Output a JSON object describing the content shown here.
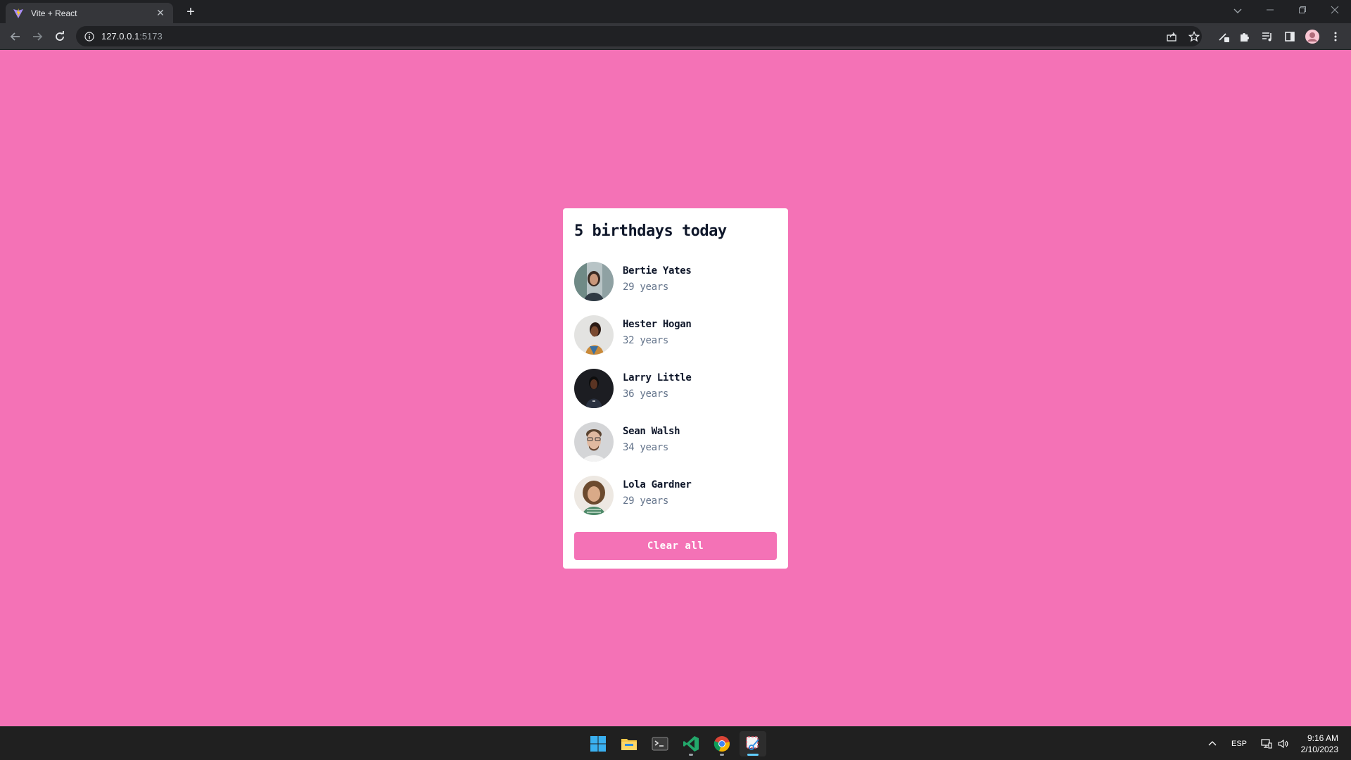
{
  "browser": {
    "tab_title": "Vite + React",
    "url_host": "127.0.0.1",
    "url_port": ":5173"
  },
  "app": {
    "heading": "5 birthdays today",
    "people": [
      {
        "name": "Bertie Yates",
        "age": "29 years"
      },
      {
        "name": "Hester Hogan",
        "age": "32 years"
      },
      {
        "name": "Larry Little",
        "age": "36 years"
      },
      {
        "name": "Sean Walsh",
        "age": "34 years"
      },
      {
        "name": "Lola Gardner",
        "age": "29 years"
      }
    ],
    "clear_label": "Clear all",
    "colors": {
      "background": "#f472b6",
      "card": "#ffffff",
      "accent": "#f472b6"
    }
  },
  "taskbar": {
    "language": "ESP",
    "time": "9:16 AM",
    "date": "2/10/2023"
  }
}
